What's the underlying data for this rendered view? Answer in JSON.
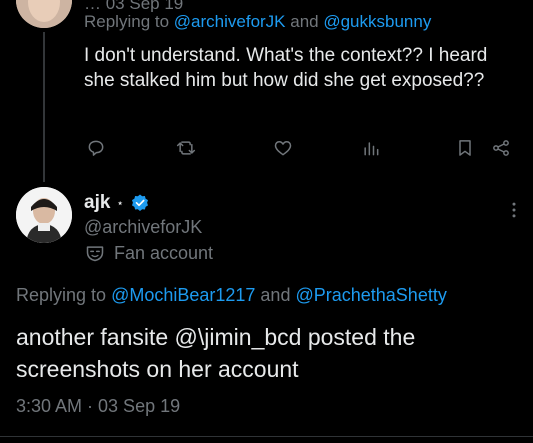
{
  "parent_tweet": {
    "header_partial": "… 03 Sep 19",
    "replying_prefix": "Replying to ",
    "replying_mentions": [
      "@archiveforJK",
      "@gukksbunny"
    ],
    "replying_joiner": " and ",
    "text": "I don't understand. What's the context?? I heard she stalked him but how did she get exposed??",
    "actions": {
      "reply_icon": "reply-icon",
      "retweet_icon": "retweet-icon",
      "like_icon": "heart-icon",
      "views_icon": "views-icon",
      "bookmark_icon": "bookmark-icon",
      "share_icon": "share-icon"
    }
  },
  "main_tweet": {
    "display_name": "ajk",
    "name_suffix": "⋆",
    "handle": "@archiveforJK",
    "badge_label": "Fan account",
    "replying_prefix": "Replying to ",
    "replying_mentions": [
      "@MochiBear1217",
      "@PrachethaShetty"
    ],
    "replying_joiner": " and ",
    "text": "another fansite @\\jimin_bcd posted the screenshots on her account",
    "timestamp": "3:30 AM · 03 Sep 19"
  },
  "colors": {
    "background": "#000000",
    "text": "#e7e9ea",
    "secondary": "#71767b",
    "accent": "#1d9bf0"
  }
}
